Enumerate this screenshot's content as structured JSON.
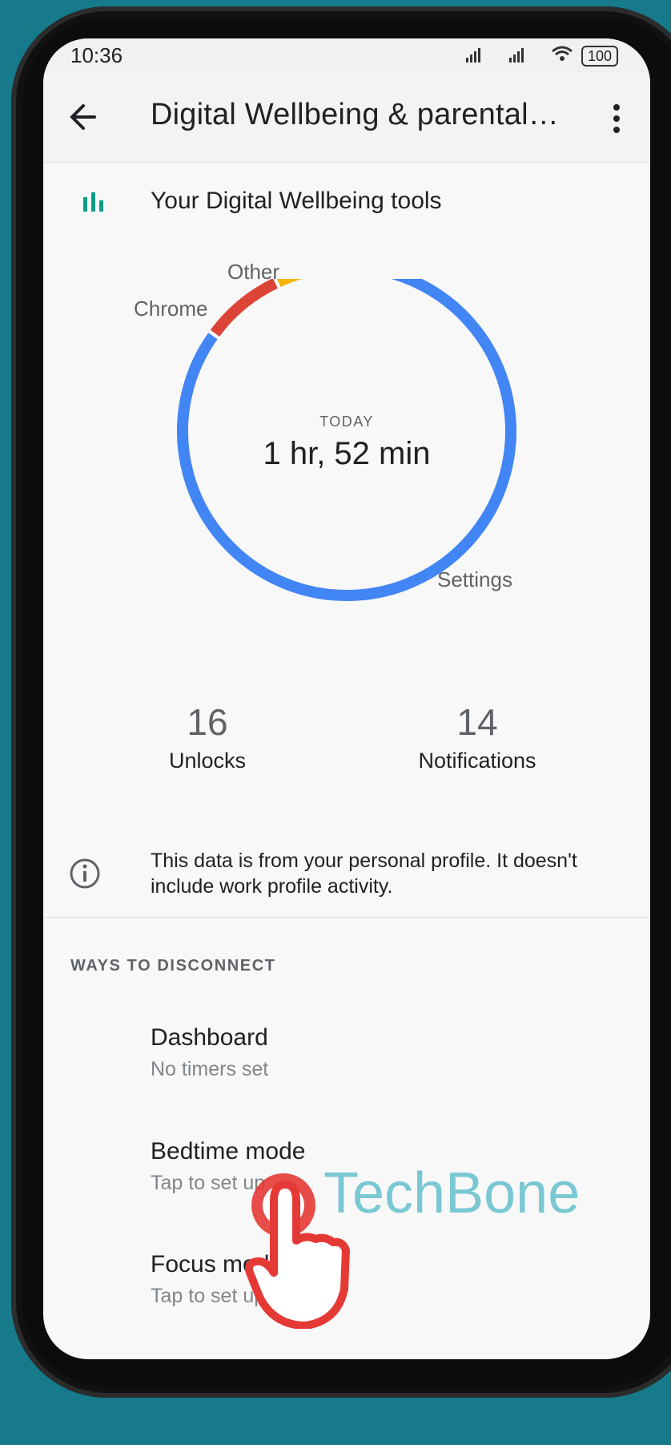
{
  "status_bar": {
    "time": "10:36",
    "battery": "100"
  },
  "app_bar": {
    "title": "Digital Wellbeing & parental…"
  },
  "tools": {
    "label": "Your Digital Wellbeing tools"
  },
  "chart_data": {
    "type": "pie",
    "categories": [
      "Settings",
      "Chrome",
      "Other"
    ],
    "values": [
      85,
      8,
      7
    ],
    "colors": [
      "#4285f4",
      "#db4437",
      "#f4b400"
    ],
    "center_label": "TODAY",
    "center_value": "1 hr, 52 min"
  },
  "stats": {
    "unlocks": {
      "value": "16",
      "label": "Unlocks"
    },
    "notifications": {
      "value": "14",
      "label": "Notifications"
    }
  },
  "info": {
    "text": "This data is from your personal profile. It doesn't include work profile activity."
  },
  "section": {
    "title": "WAYS TO DISCONNECT"
  },
  "items": [
    {
      "title": "Dashboard",
      "subtitle": "No timers set"
    },
    {
      "title": "Bedtime mode",
      "subtitle": "Tap to set up"
    },
    {
      "title": "Focus mode",
      "subtitle": "Tap to set up"
    }
  ],
  "watermark": "TechBone",
  "icons": {
    "back": "back-arrow-icon",
    "more": "more-vert-icon",
    "tools": "bar-chart-icon",
    "info": "info-icon"
  }
}
